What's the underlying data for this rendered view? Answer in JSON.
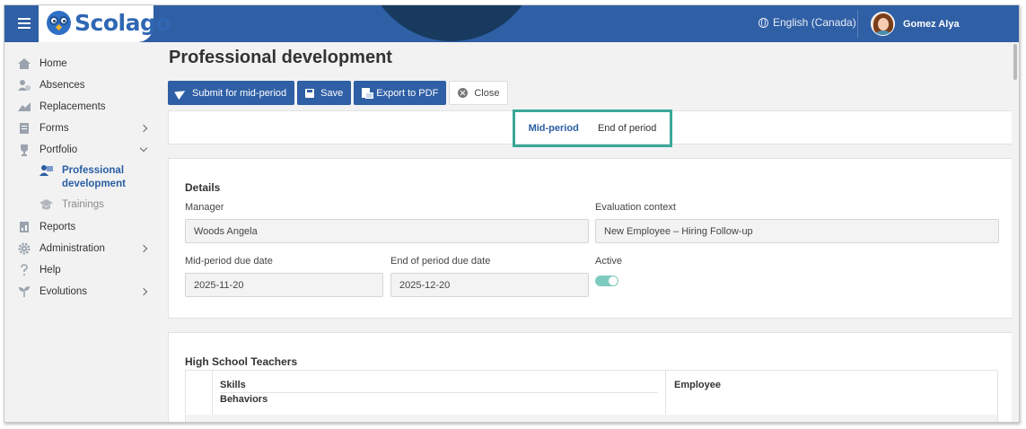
{
  "app": {
    "brand": "Scolago",
    "language": "English (Canada)",
    "user_name": "Gomez Alya"
  },
  "sidebar": {
    "items": [
      {
        "label": "Home",
        "icon": "home-icon"
      },
      {
        "label": "Absences",
        "icon": "absences-icon"
      },
      {
        "label": "Replacements",
        "icon": "replacements-icon"
      },
      {
        "label": "Forms",
        "icon": "forms-icon"
      },
      {
        "label": "Portfolio",
        "icon": "trophy-icon"
      },
      {
        "label": "Reports",
        "icon": "reports-icon"
      },
      {
        "label": "Administration",
        "icon": "gear-icon"
      },
      {
        "label": "Help",
        "icon": "question-icon"
      },
      {
        "label": "Evolutions",
        "icon": "sprout-icon"
      }
    ],
    "portfolio_sub": [
      {
        "label_line1": "Professional",
        "label_line2": "development"
      },
      {
        "label": "Trainings"
      }
    ]
  },
  "page": {
    "title": "Professional development"
  },
  "toolbar": {
    "submit_label": "Submit for mid-period",
    "save_label": "Save",
    "export_label": "Export to PDF",
    "close_label": "Close"
  },
  "tabs": {
    "mid": "Mid-period",
    "end": "End of period"
  },
  "details": {
    "title": "Details",
    "manager_label": "Manager",
    "manager_value": "Woods Angela",
    "context_label": "Evaluation context",
    "context_value": "New Employee – Hiring Follow-up",
    "mid_due_label": "Mid-period due date",
    "mid_due_value": "2025-11-20",
    "end_due_label": "End of period due date",
    "end_due_value": "2025-12-20",
    "active_label": "Active",
    "active": true
  },
  "section": {
    "title": "High School Teachers",
    "col_skills": "Skills",
    "col_behaviors": "Behaviors",
    "col_employee": "Employee"
  },
  "colors": {
    "brand_blue": "#2f5fa5",
    "tab_highlight": "#3aa899",
    "toggle_on": "#7dcbbf"
  }
}
